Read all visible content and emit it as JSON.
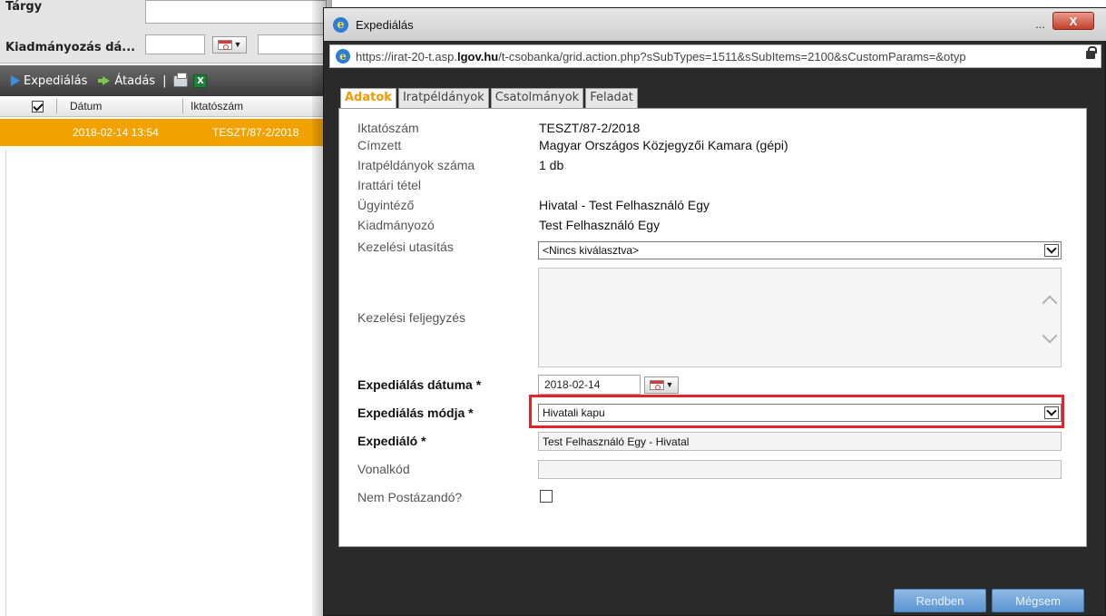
{
  "background": {
    "labels": {
      "subject": "Tárgy",
      "issue_date": "Kiadmányozás dá..."
    },
    "toolbar": {
      "expedition": "Expediálás",
      "handover": "Átadás",
      "separator": "|",
      "excel": "X"
    },
    "grid": {
      "columns": [
        "Dátum",
        "Iktatószám"
      ],
      "rows": [
        {
          "date": "2018-02-14 13:54",
          "number": "TESZT/87-2/2018"
        }
      ],
      "selected_color": "#f2a200"
    }
  },
  "window": {
    "title": "Expediálás",
    "minimize": "...",
    "close": "X",
    "url_prefix": "https://irat-20-t.asp.",
    "url_host": "lgov.hu",
    "url_rest": "/t-csobanka/grid.action.php?sSubTypes=1511&sSubItems=2100&sCustomParams=&otyp",
    "ie_icon": "e"
  },
  "tabs": [
    "Adatok",
    "Iratpéldányok",
    "Csatolmányok",
    "Feladat"
  ],
  "form": {
    "iktatoszam": {
      "label": "Iktatószám",
      "value": "TESZT/87-2/2018"
    },
    "cimzett": {
      "label": "Címzett",
      "value": "Magyar Országos Közjegyzői Kamara (gépi)"
    },
    "iratpeldanyok": {
      "label": "Iratpéldányok száma",
      "value": "1 db"
    },
    "irattari": {
      "label": "Irattári tétel",
      "value": ""
    },
    "ugyintezo": {
      "label": "Ügyintéző",
      "value": "Hivatal - Test Felhasználó Egy"
    },
    "kiadmanyozo": {
      "label": "Kiadmányozó",
      "value": "Test Felhasználó Egy"
    },
    "kezelesi_utasitas": {
      "label": "Kezelési utasítás",
      "value": "<Nincs kiválasztva>"
    },
    "kezelesi_feljegyzes": {
      "label": "Kezelési feljegyzés",
      "value": ""
    },
    "expedialas_datuma": {
      "label": "Expediálás dátuma *",
      "value": "2018-02-14"
    },
    "expedialas_modja": {
      "label": "Expediálás módja *",
      "value": "Hivatali kapu"
    },
    "expedialo": {
      "label": "Expediáló *",
      "value": "Test Felhasználó Egy - Hivatal"
    },
    "vonalkod": {
      "label": "Vonalkód",
      "value": ""
    },
    "nem_postazando": {
      "label": "Nem Postázandó?",
      "checked": false
    }
  },
  "buttons": {
    "ok": "Rendben",
    "cancel": "Mégsem"
  },
  "colors": {
    "accent": "#f29a00",
    "highlight": "#e1242b",
    "button": "#6fa4da"
  }
}
